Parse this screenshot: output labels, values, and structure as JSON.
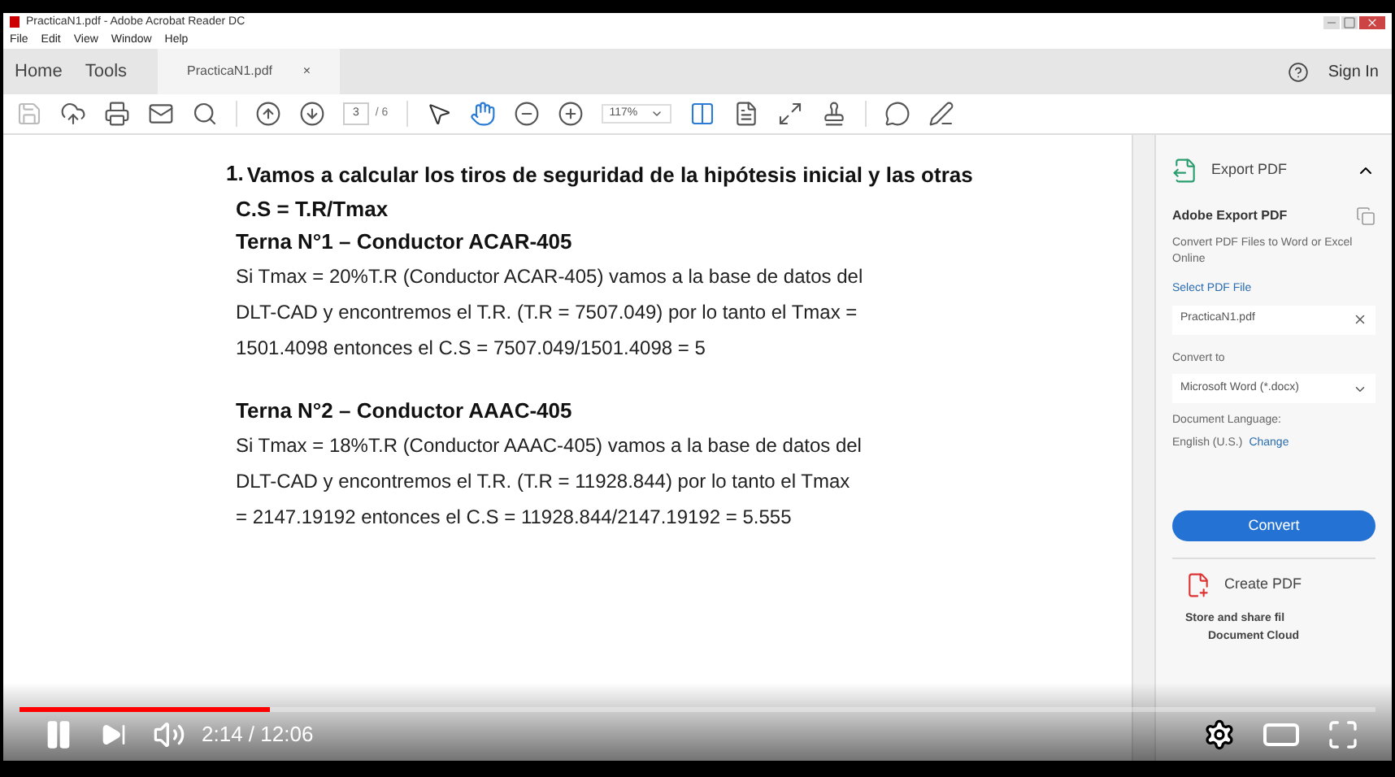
{
  "window": {
    "title": "PracticaN1.pdf - Adobe Acrobat Reader DC"
  },
  "menu": [
    "File",
    "Edit",
    "View",
    "Window",
    "Help"
  ],
  "nav_tabs": [
    {
      "label": "Home",
      "selected": false
    },
    {
      "label": "Tools",
      "selected": false
    }
  ],
  "doc_tab": {
    "label": "PracticaN1.pdf",
    "close": "×"
  },
  "sign_in": "Sign In",
  "toolbar": {
    "page": "3",
    "page_count": "/ 6",
    "zoom": "117%"
  },
  "document": {
    "heading_number": "1.",
    "heading": "Vamos a calcular los tiros de seguridad de la hipótesis inicial y las otras",
    "formula": "C.S = T.R/Tmax",
    "sections": [
      {
        "title": "Terna N°1 – Conductor ACAR-405",
        "lines": [
          "Si Tmax = 20%T.R (Conductor ACAR-405) vamos a la base de datos del",
          "DLT-CAD y encontremos el T.R. (T.R = 7507.049)  por lo tanto el Tmax =",
          "1501.4098 entonces el C.S = 7507.049/1501.4098 = 5"
        ]
      },
      {
        "title": "Terna N°2 – Conductor AAAC-405",
        "lines": [
          "Si Tmax = 18%T.R (Conductor AAAC-405) vamos a la base de datos del",
          "DLT-CAD y encontremos el T.R. (T.R = 11928.844)  por lo tanto el Tmax",
          "= 2147.19192  entonces el C.S = 11928.844/2147.19192 = 5.555"
        ]
      }
    ]
  },
  "right_pane": {
    "export_title": "Export PDF",
    "expanded": true,
    "panel_title": "Adobe Export PDF",
    "description": "Convert PDF Files to Word or Excel Online",
    "select_label": "Select PDF File",
    "file": "PracticaN1.pdf",
    "convert_to_label": "Convert to",
    "format": "Microsoft Word (*.docx)",
    "language_label": "Document Language:",
    "language": "English (U.S.)",
    "change": "Change",
    "convert_button": "Convert",
    "create_pdf": "Create PDF",
    "cloud_text": "Store and share fil",
    "cloud_text_2": "Document Cloud"
  },
  "player": {
    "level": 0.185,
    "time": "2:14 / 12:06",
    "playing": true
  }
}
